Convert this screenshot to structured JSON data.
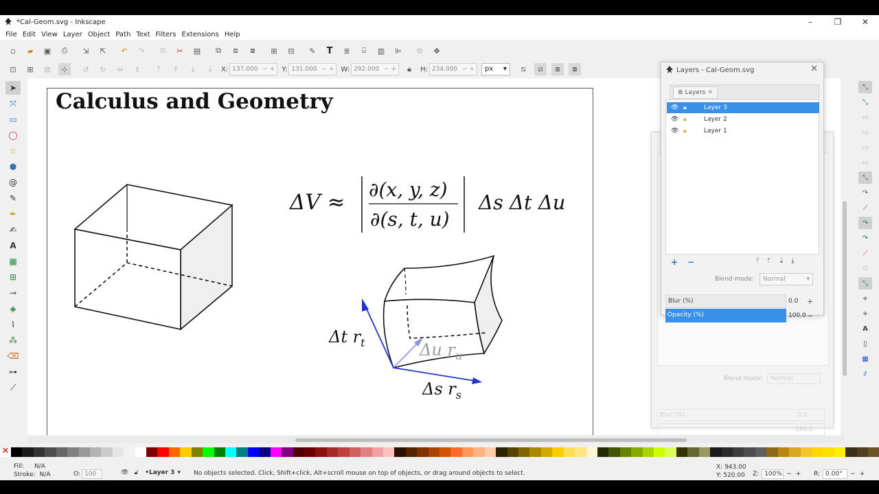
{
  "window": {
    "title": "*Cal-Geom.svg - Inkscape",
    "minimize_glyph": "–",
    "maximize_glyph": "❐",
    "close_glyph": "✕"
  },
  "menu": [
    "File",
    "Edit",
    "View",
    "Layer",
    "Object",
    "Path",
    "Text",
    "Filters",
    "Extensions",
    "Help"
  ],
  "toolbar_fields": {
    "x_label": "X:",
    "x_value": "137.000",
    "y_label": "Y:",
    "y_value": "131.000",
    "w_label": "W:",
    "w_value": "292.000",
    "h_label": "H:",
    "h_value": "234.000",
    "unit": "px"
  },
  "canvas": {
    "page_title": "Calculus and Geometry",
    "formula": {
      "lhs": "ΔV ≈",
      "numerator": "∂(x, y, z)",
      "denominator": "∂(s, t, u)",
      "rhs": "Δs Δt Δu"
    },
    "vector_labels": {
      "t_main": "Δt r",
      "t_sub": "t",
      "u_main": "Δu r",
      "u_sub": "u",
      "s_main": "Δs r",
      "s_sub": "s"
    },
    "colors": {
      "vector_blue": "#2233cc",
      "vector_light": "#8a8fe0",
      "face_fill": "#efefef"
    }
  },
  "layers_dialog": {
    "title": "Layers - Cal-Geom.svg",
    "tab_label": "Layers",
    "layers": [
      {
        "name": "Layer 3",
        "selected": true
      },
      {
        "name": "Layer 2",
        "selected": false
      },
      {
        "name": "Layer 1",
        "selected": false
      }
    ],
    "blend_label": "Blend mode:",
    "blend_value": "Normal",
    "blur_label": "Blur (%)",
    "blur_value": "0.0",
    "opacity_label": "Opacity (%)",
    "opacity_value": "100.0"
  },
  "back_dialog": {
    "blend_label": "Blend mode:",
    "blend_value": "Normal",
    "blur_label": "Blur (%)",
    "blur_value": "0.0",
    "opacity_value": "100.0"
  },
  "status": {
    "fill_label": "Fill:",
    "fill_value": "N/A",
    "stroke_label": "Stroke:",
    "stroke_value": "N/A",
    "opacity_label": "O:",
    "opacity_value": "100",
    "current_layer": "•Layer 3",
    "message": "No objects selected. Click, Shift+click, Alt+scroll mouse on top of objects, or drag around objects to select.",
    "x_label": "X:",
    "x_value": "943.00",
    "y_label": "Y:",
    "y_value": "520.00",
    "zoom_label": "Z:",
    "zoom_value": "100%",
    "rotate_label": "R:",
    "rotate_value": "0.00°"
  },
  "palette": [
    "#000000",
    "#1a1a1a",
    "#333333",
    "#4d4d4d",
    "#666666",
    "#808080",
    "#999999",
    "#b3b3b3",
    "#cccccc",
    "#e6e6e6",
    "#f2f2f2",
    "#ffffff",
    "#800000",
    "#ff0000",
    "#ff6600",
    "#ffcc00",
    "#808000",
    "#00ff00",
    "#008000",
    "#00ffff",
    "#008080",
    "#0000ff",
    "#000080",
    "#ff00ff",
    "#800080",
    "#550000",
    "#6a0000",
    "#8a1010",
    "#a52a2a",
    "#c04040",
    "#d06060",
    "#e08080",
    "#f0a0a0",
    "#ffc0c0",
    "#2b1100",
    "#552200",
    "#803300",
    "#aa4400",
    "#d45500",
    "#ff6a2a",
    "#ff9955",
    "#ffb380",
    "#ffccaa",
    "#2b2200",
    "#554400",
    "#806600",
    "#aa8800",
    "#d4aa00",
    "#ffcc00",
    "#ffdd55",
    "#ffe680",
    "#fff6d5",
    "#222b00",
    "#445500",
    "#668000",
    "#88aa00",
    "#aad400",
    "#ccff00",
    "#ddff55",
    "#333300",
    "#666633",
    "#999966",
    "#1a1a1a",
    "#2b2b2b",
    "#3c3c3c",
    "#4d4d4d",
    "#5e5e5e",
    "#8b6914",
    "#b8860b",
    "#daa520",
    "#f4c430",
    "#ffd700",
    "#ffdf00",
    "#fff000",
    "#3a2e1a",
    "#50401f",
    "#6b5227"
  ]
}
